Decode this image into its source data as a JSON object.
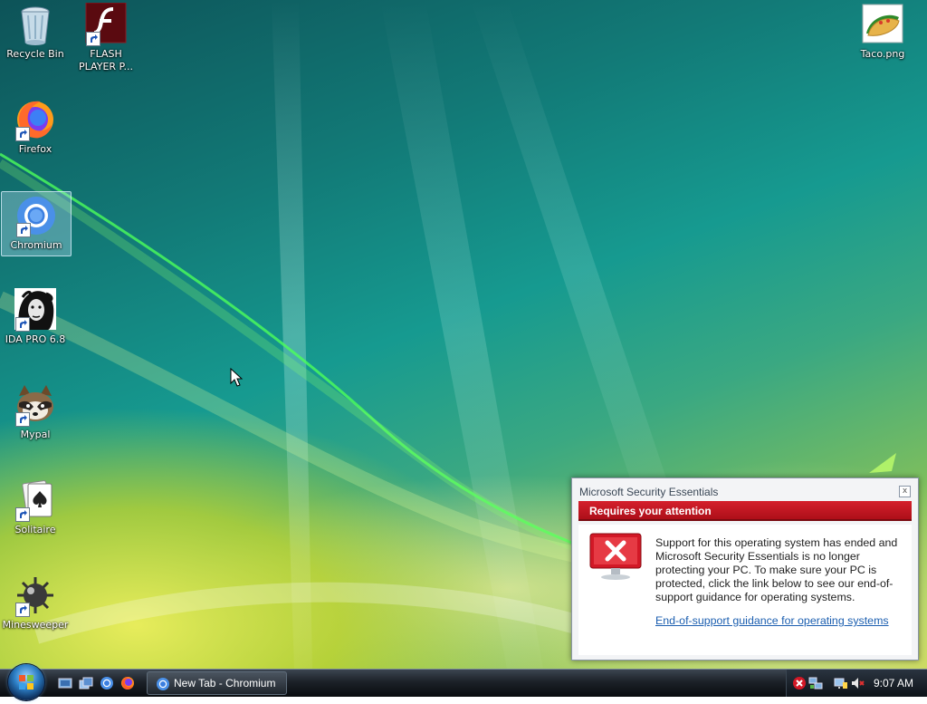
{
  "desktop": {
    "icons": [
      {
        "label": "Recycle Bin",
        "icon": "recycle-bin-icon",
        "shortcut": false
      },
      {
        "label": "FLASH\nPLAYER P...",
        "icon": "flash-player-icon",
        "shortcut": true
      },
      {
        "label": "Firefox",
        "icon": "firefox-icon",
        "shortcut": true
      },
      {
        "label": "Chromium",
        "icon": "chromium-icon",
        "shortcut": true,
        "selected": true
      },
      {
        "label": "IDA PRO 6.8",
        "icon": "ida-pro-icon",
        "shortcut": true
      },
      {
        "label": "Mypal",
        "icon": "mypal-icon",
        "shortcut": true
      },
      {
        "label": "Solitaire",
        "icon": "solitaire-icon",
        "shortcut": true
      },
      {
        "label": "Minesweeper",
        "icon": "minesweeper-icon",
        "shortcut": true
      },
      {
        "label": "Taco.png",
        "icon": "taco-image-icon",
        "shortcut": false
      }
    ]
  },
  "notification": {
    "app_title": "Microsoft Security Essentials",
    "close_symbol": "x",
    "banner": "Requires your attention",
    "message": "Support for this operating system has ended and Microsoft Security Essentials is no longer protecting your PC. To make sure your PC is protected, click the link below to see our end-of-support guidance for operating systems.",
    "link": "End-of-support guidance for operating systems",
    "status_color": "#c8101c"
  },
  "taskbar": {
    "quick_launch": [
      "show-desktop-icon",
      "switch-windows-icon",
      "chromium-icon",
      "firefox-icon"
    ],
    "tasks": [
      {
        "label": "New Tab - Chromium",
        "icon": "chromium-icon"
      }
    ],
    "tray": {
      "icons": [
        "security-alert-icon",
        "network-icon",
        "volume-muted-icon"
      ],
      "clock": "9:07 AM"
    }
  }
}
